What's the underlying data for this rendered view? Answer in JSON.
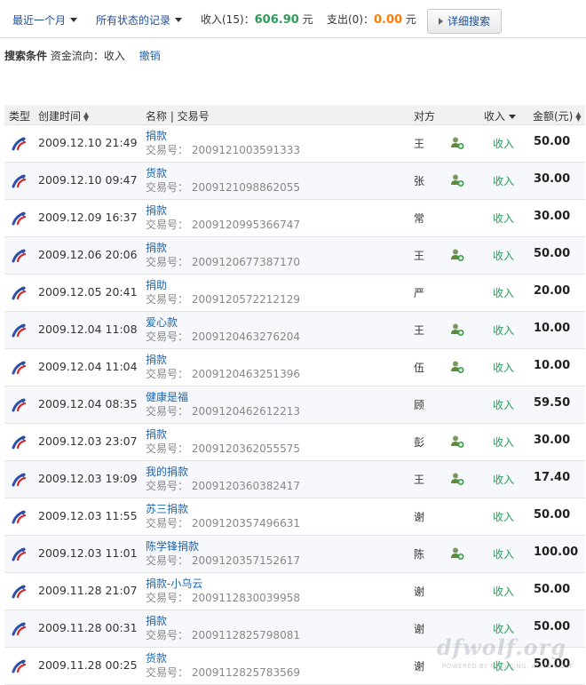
{
  "toolbar": {
    "period": "最近一个月",
    "status": "所有状态的记录",
    "income_label": "收入(15)：",
    "income_amount": "606.90",
    "income_unit": "元",
    "expense_label": "支出(0)：",
    "expense_amount": "0.00",
    "expense_unit": "元",
    "detail_search": "详细搜索"
  },
  "conditions": {
    "title": "搜索条件",
    "flow": "资金流向：收入",
    "undo": "撤销"
  },
  "table": {
    "headers": {
      "type": "类型",
      "created": "创建时间",
      "name": "名称 | 交易号",
      "party": "对方",
      "income": "收入",
      "amount": "金额(元)"
    },
    "rows": [
      {
        "time": "2009.12.10 21:49",
        "name": "捐款",
        "tx": "交易号： 2009121003591333",
        "party": "王",
        "has_user_icon": true,
        "type": "收入",
        "amount": "50.00"
      },
      {
        "time": "2009.12.10 09:47",
        "name": "货款",
        "tx": "交易号： 2009121098862055",
        "party": "张",
        "has_user_icon": true,
        "type": "收入",
        "amount": "30.00"
      },
      {
        "time": "2009.12.09 16:37",
        "name": "捐款",
        "tx": "交易号： 2009120995366747",
        "party": "常",
        "has_user_icon": false,
        "type": "收入",
        "amount": "30.00"
      },
      {
        "time": "2009.12.06 20:06",
        "name": "捐款",
        "tx": "交易号： 2009120677387170",
        "party": "王",
        "has_user_icon": true,
        "type": "收入",
        "amount": "50.00"
      },
      {
        "time": "2009.12.05 20:41",
        "name": "捐助",
        "tx": "交易号： 2009120572212129",
        "party": "严",
        "has_user_icon": false,
        "type": "收入",
        "amount": "20.00"
      },
      {
        "time": "2009.12.04 11:08",
        "name": "爱心款",
        "tx": "交易号： 2009120463276204",
        "party": "王",
        "has_user_icon": true,
        "type": "收入",
        "amount": "10.00"
      },
      {
        "time": "2009.12.04 11:04",
        "name": "捐款",
        "tx": "交易号： 2009120463251396",
        "party": "伍",
        "has_user_icon": true,
        "type": "收入",
        "amount": "10.00"
      },
      {
        "time": "2009.12.04 08:35",
        "name": "健康是福",
        "tx": "交易号： 2009120462612213",
        "party": "顾",
        "has_user_icon": false,
        "type": "收入",
        "amount": "59.50"
      },
      {
        "time": "2009.12.03 23:07",
        "name": "捐款",
        "tx": "交易号： 2009120362055575",
        "party": "彭",
        "has_user_icon": true,
        "type": "收入",
        "amount": "30.00"
      },
      {
        "time": "2009.12.03 19:09",
        "name": "我的捐款",
        "tx": "交易号： 2009120360382417",
        "party": "王",
        "has_user_icon": true,
        "type": "收入",
        "amount": "17.40"
      },
      {
        "time": "2009.12.03 11:55",
        "name": "苏三捐款",
        "tx": "交易号： 2009120357496631",
        "party": "谢",
        "has_user_icon": false,
        "type": "收入",
        "amount": "50.00"
      },
      {
        "time": "2009.12.03 11:01",
        "name": "陈学锋捐款",
        "tx": "交易号： 2009120357152617",
        "party": "陈",
        "has_user_icon": true,
        "type": "收入",
        "amount": "100.00"
      },
      {
        "time": "2009.11.28 21:07",
        "name": "捐款-小乌云",
        "tx": "交易号： 2009112830039958",
        "party": "谢",
        "has_user_icon": false,
        "type": "收入",
        "amount": "50.00"
      },
      {
        "time": "2009.11.28 00:31",
        "name": "捐款",
        "tx": "交易号： 2009112825798081",
        "party": "谢",
        "has_user_icon": false,
        "type": "收入",
        "amount": "50.00"
      },
      {
        "time": "2009.11.28 00:25",
        "name": "货款",
        "tx": "交易号： 2009112825783569",
        "party": "谢",
        "has_user_icon": false,
        "type": "收入",
        "amount": "50.00"
      }
    ]
  },
  "watermark": {
    "main": "dfwolf.org",
    "sub": "POWERED BY FOCUSING, ALIVE WOLF"
  },
  "colors": {
    "link": "#1a66b3",
    "income_green": "#2f9a5b",
    "expense_orange": "#ff7a00"
  },
  "icons": {
    "row_type": "alipay-transfer-icon",
    "party": "add-contact-icon"
  }
}
